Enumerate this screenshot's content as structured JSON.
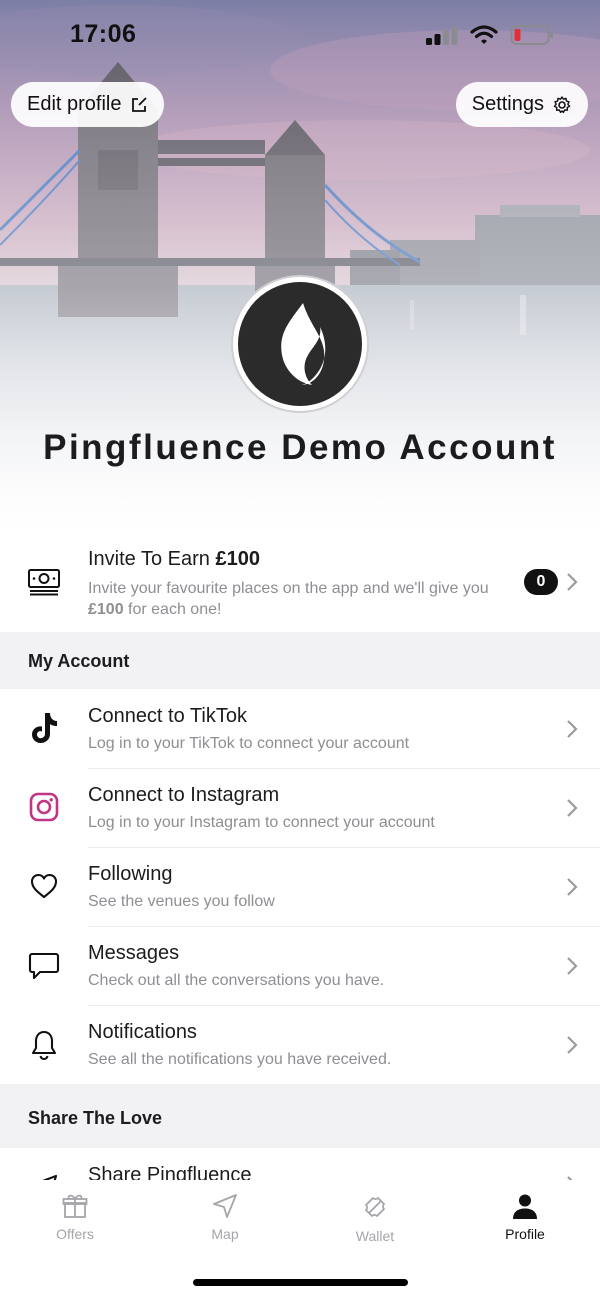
{
  "status_bar": {
    "time": "17:06"
  },
  "header": {
    "edit_profile_label": "Edit profile",
    "settings_label": "Settings",
    "profile_name": "Pingfluence Demo Account"
  },
  "invite": {
    "title_prefix": "Invite To Earn ",
    "title_amount": "£100",
    "subtitle_line1": "Invite your favourite places on the app and we'll give you",
    "subtitle_amount": "£100",
    "subtitle_line2_rest": " for each one!",
    "count": "0"
  },
  "my_account": {
    "heading": "My Account",
    "items": [
      {
        "title": "Connect to TikTok",
        "subtitle": "Log in to your TikTok to connect your account",
        "icon": "tiktok-icon"
      },
      {
        "title": "Connect to Instagram",
        "subtitle": "Log in to your Instagram to connect your account",
        "icon": "instagram-icon"
      },
      {
        "title": "Following",
        "subtitle": "See the venues you follow",
        "icon": "heart-icon"
      },
      {
        "title": "Messages",
        "subtitle": "Check out all the conversations you have.",
        "icon": "message-icon"
      },
      {
        "title": "Notifications",
        "subtitle": "See all the notifications you have received.",
        "icon": "bell-icon"
      }
    ]
  },
  "share": {
    "heading": "Share The Love",
    "items": [
      {
        "title": "Share Pingfluence",
        "icon": "share-icon"
      }
    ]
  },
  "tabbar": {
    "tabs": [
      {
        "label": "Offers",
        "icon": "gift-icon",
        "active": false
      },
      {
        "label": "Map",
        "icon": "navigation-arrow-icon",
        "active": false
      },
      {
        "label": "Wallet",
        "icon": "ticket-icon",
        "active": false
      },
      {
        "label": "Profile",
        "icon": "person-icon",
        "active": true
      }
    ]
  },
  "colors": {
    "accent": "#111111",
    "instagram": "#c13584",
    "section_bg": "#f2f2f4",
    "muted_text": "#8e8e93",
    "battery_low": "#e0303a"
  }
}
